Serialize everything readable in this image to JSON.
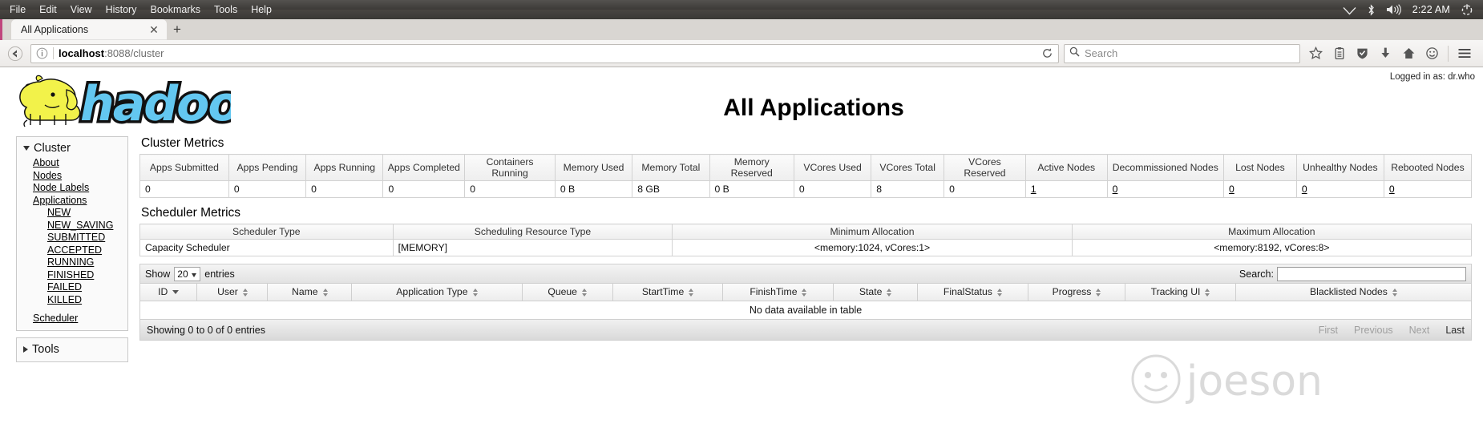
{
  "os": {
    "menu": [
      "File",
      "Edit",
      "View",
      "History",
      "Bookmarks",
      "Tools",
      "Help"
    ],
    "tray": {
      "wifi_icon": "wifi-icon",
      "bluetooth_icon": "bluetooth-icon",
      "volume_icon": "volume-icon",
      "clock": "2:22 AM",
      "power_icon": "power-icon"
    }
  },
  "browser": {
    "tab": {
      "title": "All Applications",
      "close_icon": "close-icon"
    },
    "new_tab_icon": "plus-icon",
    "back_icon": "back-arrow-icon",
    "identity_icon": "info-icon",
    "url": {
      "host": "localhost",
      "path": ":8088/cluster"
    },
    "reload_icon": "reload-icon",
    "search": {
      "placeholder": "Search",
      "icon": "search-icon"
    },
    "icons": [
      "star-icon",
      "reader-list-icon",
      "shield-icon",
      "download-icon",
      "home-icon",
      "smiley-icon",
      "hamburger-menu-icon"
    ]
  },
  "page": {
    "logged_in": "Logged in as: dr.who",
    "title": "All Applications",
    "logo_alt": "hadoop",
    "logo_text": "hadoop"
  },
  "sidebar": {
    "cluster": {
      "label": "Cluster",
      "links": [
        "About",
        "Nodes",
        "Node Labels",
        "Applications"
      ],
      "app_states": [
        "NEW",
        "NEW_SAVING",
        "SUBMITTED",
        "ACCEPTED",
        "RUNNING",
        "FINISHED",
        "FAILED",
        "KILLED"
      ],
      "scheduler": "Scheduler"
    },
    "tools": {
      "label": "Tools"
    }
  },
  "cluster_metrics": {
    "title": "Cluster Metrics",
    "headers": [
      "Apps Submitted",
      "Apps Pending",
      "Apps Running",
      "Apps Completed",
      "Containers Running",
      "Memory Used",
      "Memory Total",
      "Memory Reserved",
      "VCores Used",
      "VCores Total",
      "VCores Reserved",
      "Active Nodes",
      "Decommissioned Nodes",
      "Lost Nodes",
      "Unhealthy Nodes",
      "Rebooted Nodes"
    ],
    "values": [
      "0",
      "0",
      "0",
      "0",
      "0",
      "0 B",
      "8 GB",
      "0 B",
      "0",
      "8",
      "0",
      "1",
      "0",
      "0",
      "0",
      "0"
    ],
    "link_flags": [
      false,
      false,
      false,
      false,
      false,
      false,
      false,
      false,
      false,
      false,
      false,
      true,
      true,
      true,
      true,
      true
    ]
  },
  "scheduler_metrics": {
    "title": "Scheduler Metrics",
    "headers": [
      "Scheduler Type",
      "Scheduling Resource Type",
      "Minimum Allocation",
      "Maximum Allocation"
    ],
    "row": [
      "Capacity Scheduler",
      "[MEMORY]",
      "<memory:1024, vCores:1>",
      "<memory:8192, vCores:8>"
    ]
  },
  "datatable": {
    "show_label": "Show",
    "page_length": "20",
    "entries_label": "entries",
    "search_label": "Search:",
    "search_value": "",
    "columns": [
      "ID",
      "User",
      "Name",
      "Application Type",
      "Queue",
      "StartTime",
      "FinishTime",
      "State",
      "FinalStatus",
      "Progress",
      "Tracking UI",
      "Blacklisted Nodes"
    ],
    "empty_message": "No data available in table",
    "info": "Showing 0 to 0 of 0 entries",
    "pagination": [
      "First",
      "Previous",
      "Next",
      "Last"
    ]
  },
  "watermark": {
    "text": "joeson",
    "icon": "face-icon"
  }
}
